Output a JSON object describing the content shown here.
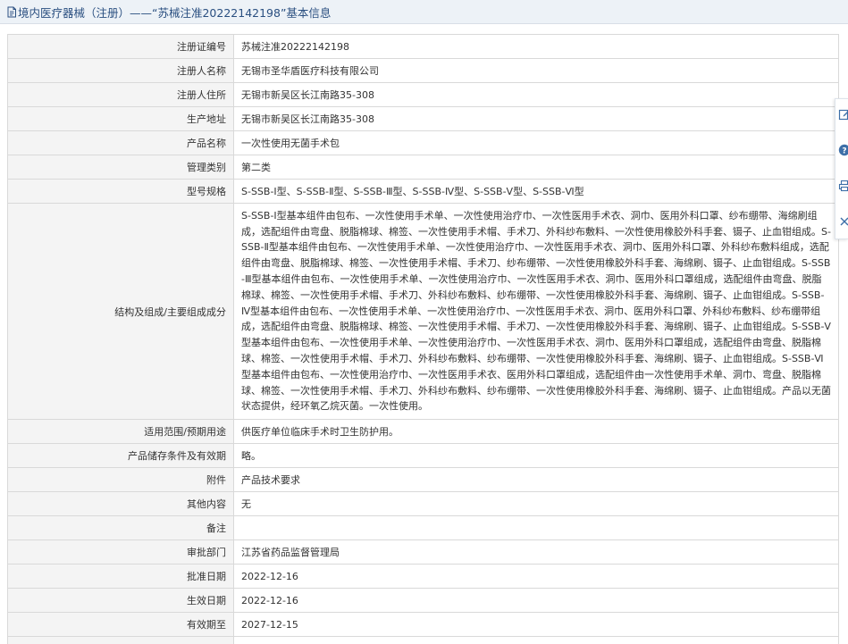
{
  "header": {
    "title": "境内医疗器械（注册）——“苏械注准20222142198”基本信息"
  },
  "fields": [
    {
      "label": "注册证编号",
      "value": "苏械注准20222142198"
    },
    {
      "label": "注册人名称",
      "value": "无锡市圣华盾医疗科技有限公司"
    },
    {
      "label": "注册人住所",
      "value": "无锡市新吴区长江南路35-308"
    },
    {
      "label": "生产地址",
      "value": "无锡市新吴区长江南路35-308"
    },
    {
      "label": "产品名称",
      "value": "一次性使用无菌手术包"
    },
    {
      "label": "管理类别",
      "value": "第二类"
    },
    {
      "label": "型号规格",
      "value": "S-SSB-Ⅰ型、S-SSB-Ⅱ型、S-SSB-Ⅲ型、S-SSB-Ⅳ型、S-SSB-Ⅴ型、S-SSB-Ⅵ型"
    },
    {
      "label": "结构及组成/主要组成成分",
      "value": "S-SSB-Ⅰ型基本组件由包布、一次性使用手术单、一次性使用治疗巾、一次性医用手术衣、洞巾、医用外科口罩、纱布绷带、海绵刷组成，选配组件由弯盘、脱脂棉球、棉签、一次性使用手术帽、手术刀、外科纱布敷料、一次性使用橡胶外科手套、镊子、止血钳组成。S-SSB-Ⅱ型基本组件由包布、一次性使用手术单、一次性使用治疗巾、一次性医用手术衣、洞巾、医用外科口罩、外科纱布敷料组成，选配组件由弯盘、脱脂棉球、棉签、一次性使用手术帽、手术刀、纱布绷带、一次性使用橡胶外科手套、海绵刷、镊子、止血钳组成。S-SSB-Ⅲ型基本组件由包布、一次性使用手术单、一次性使用治疗巾、一次性医用手术衣、洞巾、医用外科口罩组成，选配组件由弯盘、脱脂棉球、棉签、一次性使用手术帽、手术刀、外科纱布敷料、纱布绷带、一次性使用橡胶外科手套、海绵刷、镊子、止血钳组成。S-SSB-Ⅳ型基本组件由包布、一次性使用手术单、一次性使用治疗巾、一次性医用手术衣、洞巾、医用外科口罩、外科纱布敷料、纱布绷带组成，选配组件由弯盘、脱脂棉球、棉签、一次性使用手术帽、手术刀、一次性使用橡胶外科手套、海绵刷、镊子、止血钳组成。S-SSB-Ⅴ型基本组件由包布、一次性使用手术单、一次性使用治疗巾、一次性医用手术衣、洞巾、医用外科口罩组成，选配组件由弯盘、脱脂棉球、棉签、一次性使用手术帽、手术刀、外科纱布敷料、纱布绷带、一次性使用橡胶外科手套、海绵刷、镊子、止血钳组成。S-SSB-Ⅵ型基本组件由包布、一次性使用治疗巾、一次性医用手术衣、医用外科口罩组成，选配组件由一次性使用手术单、洞巾、弯盘、脱脂棉球、棉签、一次性使用手术帽、手术刀、外科纱布敷料、纱布绷带、一次性使用橡胶外科手套、海绵刷、镊子、止血钳组成。产品以无菌状态提供，经环氧乙烷灭菌。一次性使用。"
    },
    {
      "label": "适用范围/预期用途",
      "value": "供医疗单位临床手术时卫生防护用。"
    },
    {
      "label": "产品储存条件及有效期",
      "value": "略。"
    },
    {
      "label": "附件",
      "value": "产品技术要求"
    },
    {
      "label": "其他内容",
      "value": "无"
    },
    {
      "label": "备注",
      "value": ""
    },
    {
      "label": "审批部门",
      "value": "江苏省药品监督管理局"
    },
    {
      "label": "批准日期",
      "value": "2022-12-16"
    },
    {
      "label": "生效日期",
      "value": "2022-12-16"
    },
    {
      "label": "有效期至",
      "value": "2027-12-15"
    },
    {
      "label": "",
      "value": ""
    }
  ],
  "toolbar": {
    "icons": [
      "edit-icon",
      "help-icon",
      "print-icon",
      "close-icon"
    ]
  },
  "colors": {
    "title_text": "#2a4f80",
    "title_bg": "#edf2f7",
    "label_bg": "#f4f4f4",
    "border": "#d9d9d9",
    "toolbar_icon": "#3d6fa8"
  }
}
